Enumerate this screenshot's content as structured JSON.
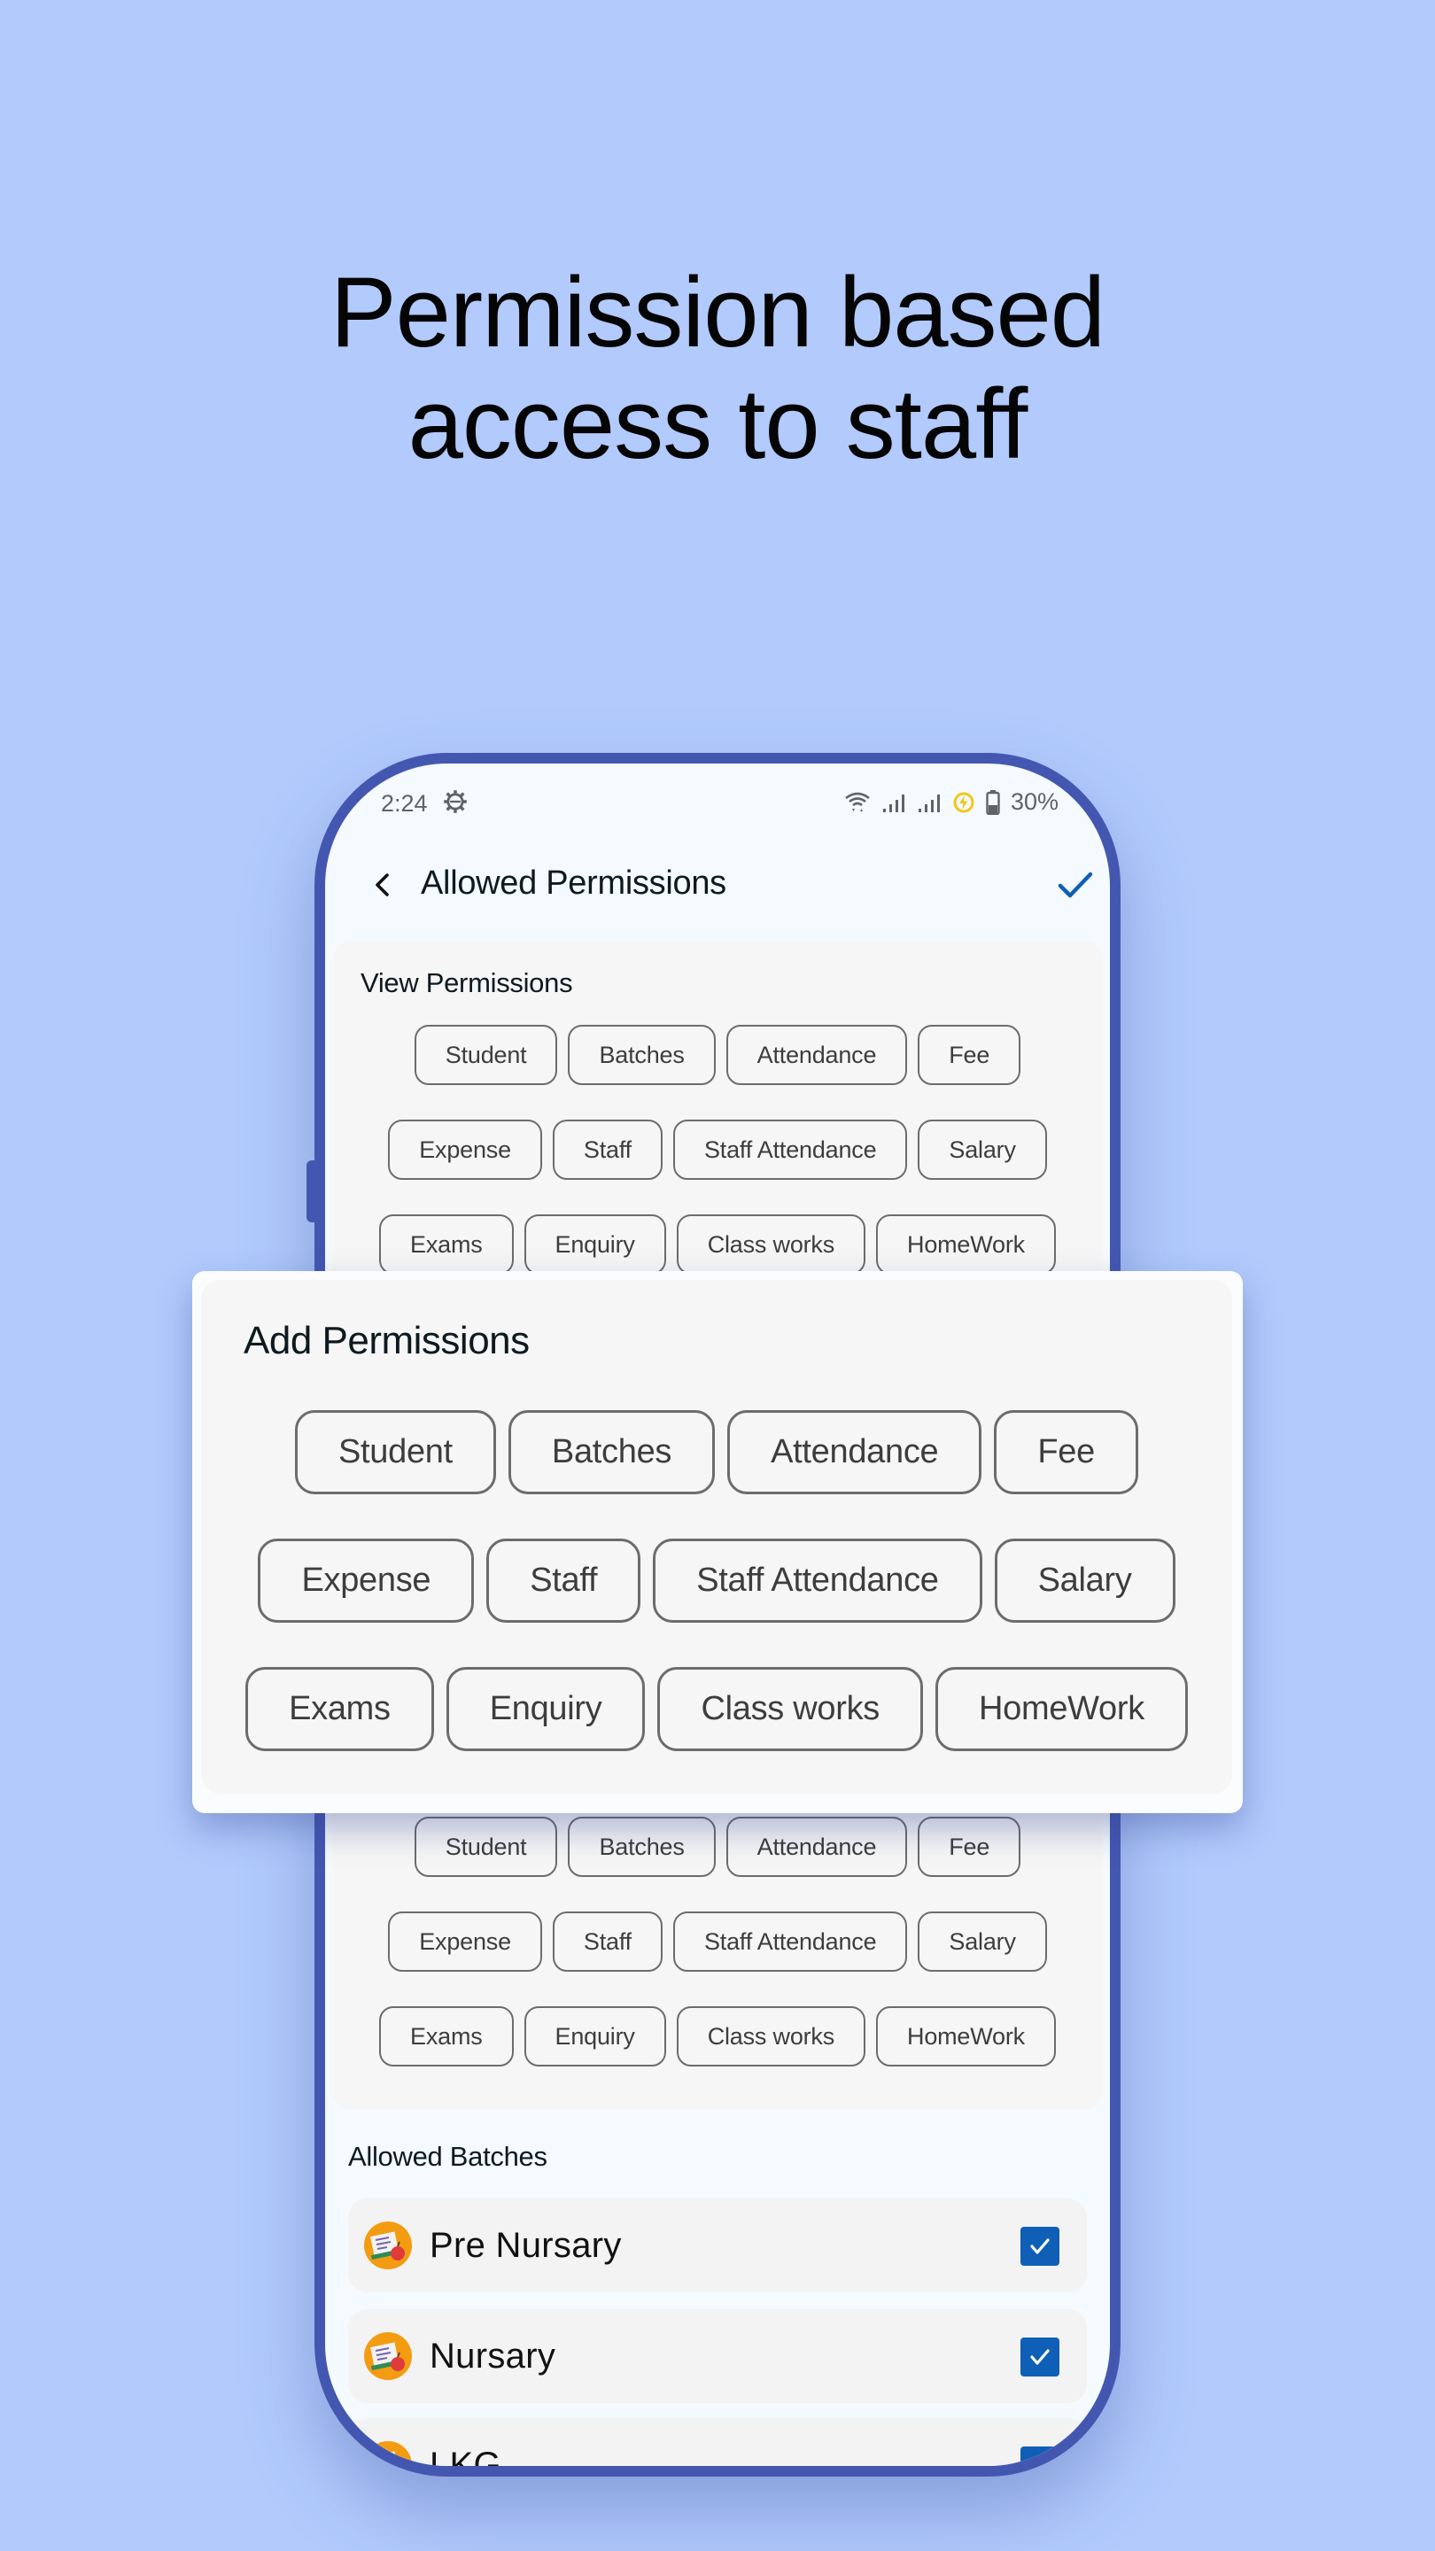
{
  "headline": {
    "line1": "Permission based",
    "line2": "access to staff"
  },
  "colors": {
    "background": "#b2cafc",
    "phone_frame": "#4457b0",
    "accent": "#0e5fb5",
    "batch_icon": "#f39c12",
    "charging_icon": "#f5c518"
  },
  "status_bar": {
    "time": "2:24",
    "battery_percent": "30%",
    "icons": [
      "settings-gear-icon",
      "wifi-icon",
      "signal-icon",
      "signal-icon",
      "power-saving-icon",
      "battery-icon"
    ]
  },
  "app_bar": {
    "title": "Allowed Permissions",
    "back_icon": "chevron-left-icon",
    "confirm_icon": "checkmark-icon"
  },
  "view_permissions": {
    "heading": "View Permissions",
    "rows": [
      [
        "Student",
        "Batches",
        "Attendance",
        "Fee"
      ],
      [
        "Expense",
        "Staff",
        "Staff Attendance",
        "Salary"
      ],
      [
        "Exams",
        "Enquiry",
        "Class works",
        "HomeWork"
      ]
    ]
  },
  "add_permissions": {
    "heading": "Add Permissions",
    "rows": [
      [
        "Student",
        "Batches",
        "Attendance",
        "Fee"
      ],
      [
        "Expense",
        "Staff",
        "Staff Attendance",
        "Salary"
      ],
      [
        "Exams",
        "Enquiry",
        "Class works",
        "HomeWork"
      ]
    ]
  },
  "lower_permissions": {
    "rows": [
      [
        "Student",
        "Batches",
        "Attendance",
        "Fee"
      ],
      [
        "Expense",
        "Staff",
        "Staff Attendance",
        "Salary"
      ],
      [
        "Exams",
        "Enquiry",
        "Class works",
        "HomeWork"
      ]
    ]
  },
  "allowed_batches": {
    "heading": "Allowed Batches",
    "items": [
      {
        "name": "Pre Nursary",
        "checked": true
      },
      {
        "name": "Nursary",
        "checked": true
      },
      {
        "name": "LKG",
        "checked": true
      }
    ]
  }
}
